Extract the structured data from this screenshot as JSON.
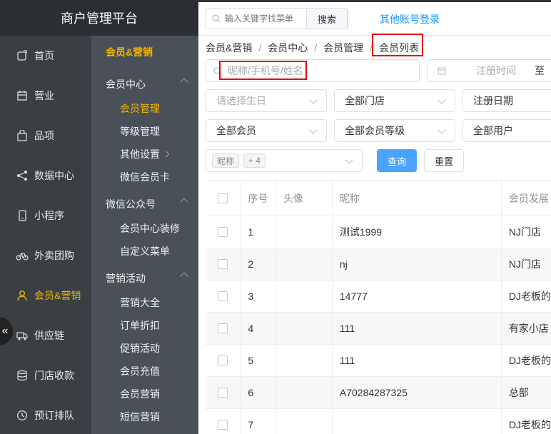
{
  "brand": "商户管理平台",
  "nav_main": [
    {
      "label": "首页",
      "icon": "home-icon"
    },
    {
      "label": "营业",
      "icon": "calendar-icon"
    },
    {
      "label": "品项",
      "icon": "bag-icon"
    },
    {
      "label": "数据中心",
      "icon": "share-icon"
    },
    {
      "label": "小程序",
      "icon": "phone-icon"
    },
    {
      "label": "外卖团购",
      "icon": "bike-icon"
    },
    {
      "label": "会员&营销",
      "icon": "user-icon",
      "active": true
    },
    {
      "label": "供应链",
      "icon": "truck-icon"
    },
    {
      "label": "门店收款",
      "icon": "database-icon"
    },
    {
      "label": "预订排队",
      "icon": "clock-icon"
    }
  ],
  "nav_sub": {
    "title": "会员&营销",
    "groups": [
      {
        "label": "会员中心",
        "items": [
          "会员管理",
          "等级管理",
          "其他设置",
          "微信会员卡"
        ]
      },
      {
        "label": "微信公众号",
        "items": [
          "会员中心装修",
          "自定义菜单"
        ]
      },
      {
        "label": "营销活动",
        "items": [
          "营销大全",
          "订单折扣",
          "促销活动",
          "会员充值",
          "会员营销",
          "短信营销"
        ]
      }
    ]
  },
  "topbar": {
    "search_placeholder": "输入关键字找菜单",
    "search_button": "搜索",
    "other_login": "其他账号登录"
  },
  "breadcrumb": [
    "会员&营销",
    "会员中心",
    "会员管理",
    "会员列表"
  ],
  "filters": {
    "keyword_placeholder": "昵称/手机号/姓名",
    "register_time_placeholder": "注册时间",
    "register_time_to": "至",
    "birthday_placeholder": "请选择生日",
    "store": "全部门店",
    "register_date": "注册日期",
    "member_type": "全部会员",
    "member_level": "全部会员等级",
    "user_type": "全部用户",
    "tag_selected": "昵称",
    "tag_more": "+ 4",
    "query_button": "查询",
    "reset_button": "重置"
  },
  "table": {
    "headers": [
      "序号",
      "头像",
      "昵称",
      "会员发展"
    ],
    "rows": [
      {
        "no": "1",
        "nickname": "测试1999",
        "origin": "NJ门店"
      },
      {
        "no": "2",
        "nickname": "nj",
        "origin": "NJ门店"
      },
      {
        "no": "3",
        "nickname": "14777",
        "origin": "DJ老板的"
      },
      {
        "no": "4",
        "nickname": "111",
        "origin": "有家小店"
      },
      {
        "no": "5",
        "nickname": "111",
        "origin": "DJ老板的"
      },
      {
        "no": "6",
        "nickname": "A70284287325",
        "origin": "总部"
      },
      {
        "no": "7",
        "nickname": "",
        "origin": "DJ老板的"
      }
    ]
  },
  "colors": {
    "accent": "#f5b400",
    "primary": "#4aa3ff",
    "link": "#1890ff",
    "highlight": "#e60000"
  }
}
